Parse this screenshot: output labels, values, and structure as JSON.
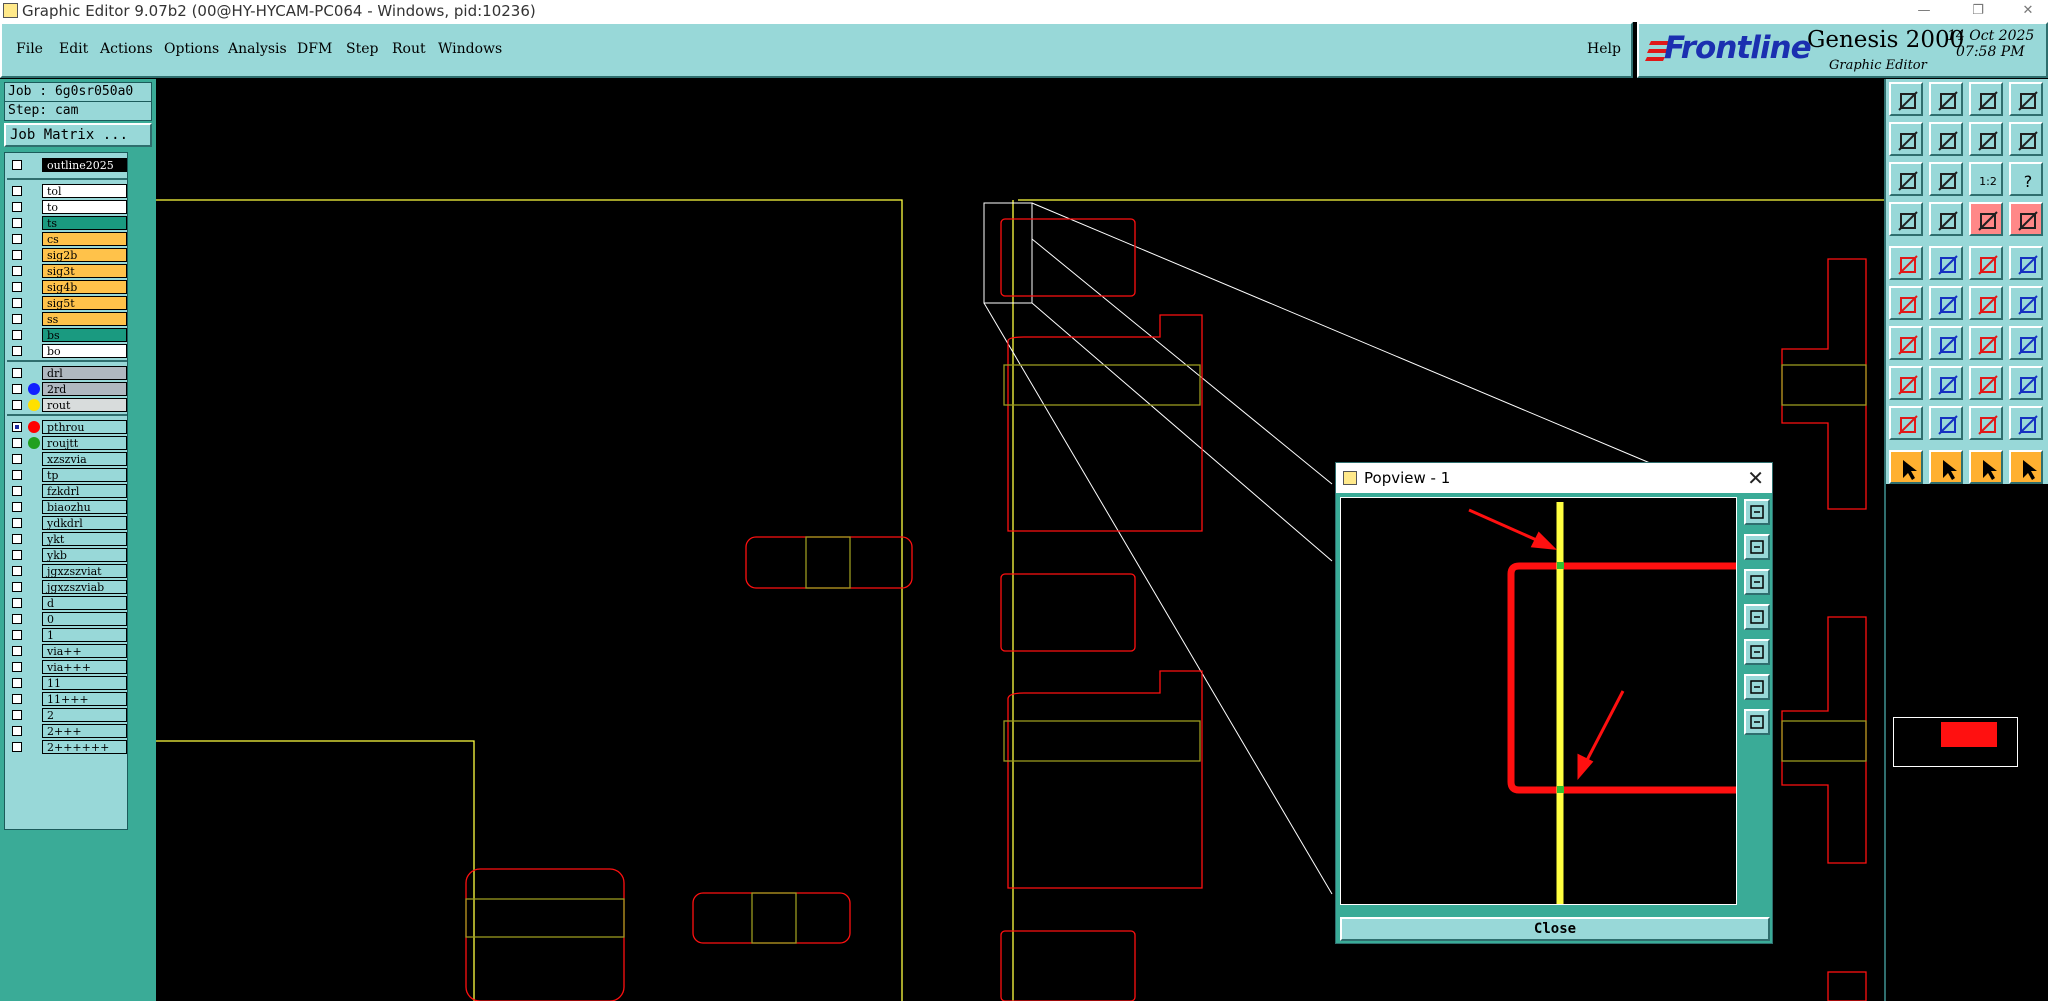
{
  "window": {
    "title": "Graphic Editor 9.07b2 (00@HY-HYCAM-PC064 - Windows, pid:10236)",
    "minimize_glyph": "—",
    "restore_glyph": "❐",
    "close_glyph": "✕"
  },
  "menu": {
    "items": [
      "File",
      "Edit",
      "Actions",
      "Options",
      "Analysis",
      "DFM",
      "Step",
      "Rout",
      "Windows"
    ],
    "help": "Help"
  },
  "brand": {
    "logo": "Frontline",
    "product": "Genesis 2000",
    "subtitle": "Graphic Editor",
    "date": "14 Oct 2025",
    "time": "07:58 PM"
  },
  "left": {
    "job": "Job : 6g0sr050a0",
    "step": "Step: cam",
    "job_matrix": "Job Matrix ..."
  },
  "layers": [
    {
      "name": "outline2025",
      "color": "#000000",
      "text_color": "#ffffff"
    },
    {
      "name": "tol",
      "color": "#ffffff"
    },
    {
      "name": "to",
      "color": "#ffffff"
    },
    {
      "name": "ts",
      "color": "#1a9a80"
    },
    {
      "name": "cs",
      "color": "#ffc24a"
    },
    {
      "name": "sig2b",
      "color": "#ffc24a"
    },
    {
      "name": "sig3t",
      "color": "#ffc24a"
    },
    {
      "name": "sig4b",
      "color": "#ffc24a"
    },
    {
      "name": "sig5t",
      "color": "#ffc24a"
    },
    {
      "name": "ss",
      "color": "#ffc24a"
    },
    {
      "name": "bs",
      "color": "#1a9a80"
    },
    {
      "name": "bo",
      "color": "#ffffff"
    },
    {
      "name": "drl",
      "color": "#b0b8c0"
    },
    {
      "name": "2rd",
      "color": "#b0b8c0",
      "dot": "#1020ff"
    },
    {
      "name": "rout",
      "color": "#d8dcdc",
      "dot": "#ffe000"
    },
    {
      "name": "pthrou",
      "color": "#98d8d8",
      "dot": "#ff0000",
      "checked": true
    },
    {
      "name": "roujtt",
      "color": "#98d8d8",
      "dot": "#20a020"
    },
    {
      "name": "xzszvia",
      "color": "#98d8d8"
    },
    {
      "name": "tp",
      "color": "#98d8d8"
    },
    {
      "name": "fzkdrl",
      "color": "#98d8d8"
    },
    {
      "name": "biaozhu",
      "color": "#98d8d8"
    },
    {
      "name": "ydkdrl",
      "color": "#98d8d8"
    },
    {
      "name": "ykt",
      "color": "#98d8d8"
    },
    {
      "name": "ykb",
      "color": "#98d8d8"
    },
    {
      "name": "jgxzszviat",
      "color": "#98d8d8"
    },
    {
      "name": "jgxzszviab",
      "color": "#98d8d8"
    },
    {
      "name": "d",
      "color": "#98d8d8"
    },
    {
      "name": "0",
      "color": "#98d8d8"
    },
    {
      "name": "1",
      "color": "#98d8d8"
    },
    {
      "name": "via++",
      "color": "#98d8d8"
    },
    {
      "name": "via+++",
      "color": "#98d8d8"
    },
    {
      "name": "11",
      "color": "#98d8d8"
    },
    {
      "name": "11+++",
      "color": "#98d8d8"
    },
    {
      "name": "2",
      "color": "#98d8d8"
    },
    {
      "name": "2+++",
      "color": "#98d8d8"
    },
    {
      "name": "2++++++",
      "color": "#98d8d8"
    }
  ],
  "toolbox": {
    "icons": [
      "load-step-icon",
      "save-step-icon",
      "home-icon",
      "panel-icon",
      "move-left-icon",
      "move-right-icon",
      "redraw-icon",
      "refresh-icon",
      "zoom-fit-icon",
      "zoom-home-icon",
      "zoom-1to2-icon",
      "help-icon",
      "measure-icon",
      "pin-icon",
      "layer-compare-icon",
      "snap-icon",
      "add-pad-icon",
      "add-line-icon",
      "add-text-icon",
      "add-surface-icon",
      "select-pads-icon",
      "cross-icon",
      "connect-icon",
      "connect-alt-icon",
      "draw-line-icon",
      "draw-line-blue-icon",
      "arc-icon",
      "align-icon",
      "move-icon",
      "minus-icon",
      "dimension-icon",
      "group-icon",
      "mirror-icon",
      "warning-icon",
      "triangle-icon",
      "triangle-alt-icon",
      "pointer-icon",
      "pointer-select-icon",
      "pointer-box-icon",
      "pointer-drag-icon"
    ]
  },
  "popview": {
    "title": "Popview - 1",
    "close_glyph": "✕",
    "close_label": "Close",
    "side_icons": [
      "popview-zoom-icon",
      "popview-save-icon",
      "popview-load-icon",
      "popview-left-icon",
      "popview-right-icon",
      "popview-fit-icon",
      "popview-center-icon"
    ]
  },
  "colors": {
    "panel": "#98d8d8",
    "panel_dark": "#3aab97",
    "trace": "#ff1010",
    "outline": "#ffff40",
    "pad": "#9a9a20"
  }
}
